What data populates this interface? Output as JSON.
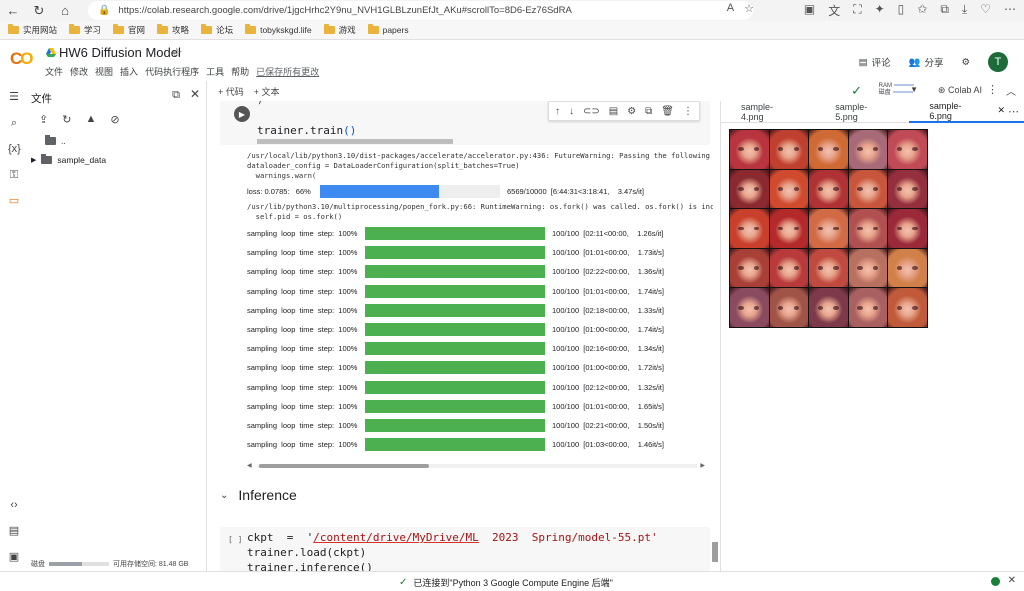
{
  "browser": {
    "url": "https://colab.research.google.com/drive/1jgcHrhc2Y9nu_NVH1GLBLzunEfJt_AKu#scrollTo=8D6-Ez76SdRA",
    "bookmarks": [
      "实用网站",
      "学习",
      "官网",
      "攻略",
      "论坛",
      "tobykskgd.life",
      "游戏",
      "papers"
    ]
  },
  "header": {
    "title": "HW6 Diffusion Model",
    "menu": [
      "文件",
      "修改",
      "视图",
      "插入",
      "代码执行程序",
      "工具",
      "帮助"
    ],
    "saved": "已保存所有更改",
    "comment": "评论",
    "share": "分享",
    "avatar_letter": "T"
  },
  "toolbar": {
    "add_code": "+ 代码",
    "add_text": "+ 文本",
    "ram": "RAM",
    "disk": "磁盘",
    "colab_ai": "Colab AI"
  },
  "files": {
    "title": "文件",
    "parent": "..",
    "folder": "sample_data",
    "disk_label": "磁盘",
    "disk_avail": "可用存储空间: 81.48 GB",
    "disk_used_fraction": 0.55
  },
  "cell1": {
    "prev": ")",
    "code_fn": "trainer.train",
    "code_parens": "()"
  },
  "output": {
    "warn1": "/usr/local/lib/python3.10/dist-packages/accelerate/accelerator.py:436: FutureWarning: Passing the following ar",
    "warn2": "dataloader_config = DataLoaderConfiguration(split_batches=True)",
    "warn3": "  warnings.warn(",
    "loss_label": "loss: 0.0785:   66%",
    "loss_tail": "6569/10000  [6:44:31<3:18:41,    3.47s/it]",
    "loss_fraction": 0.66,
    "warn4": "/usr/lib/python3.10/multiprocessing/popen_fork.py:66: RuntimeWarning: os.fork() was called. os.fork() is incom",
    "warn5": "  self.pid = os.fork()",
    "sampling_label": "sampling  loop  time  step:  100%",
    "sampling": [
      "100/100  [02:11<00:00,    1.26s/it]",
      "100/100  [01:01<00:00,    1.73it/s]",
      "100/100  [02:22<00:00,    1.36s/it]",
      "100/100  [01:01<00:00,    1.74it/s]",
      "100/100  [02:18<00:00,    1.33s/it]",
      "100/100  [01:00<00:00,    1.74it/s]",
      "100/100  [02:16<00:00,    1.34s/it]",
      "100/100  [01:00<00:00,    1.72it/s]",
      "100/100  [02:12<00:00,    1.32s/it]",
      "100/100  [01:01<00:00,    1.65it/s]",
      "100/100  [02:21<00:00,    1.50s/it]",
      "100/100  [01:03<00:00,    1.46it/s]"
    ],
    "sampling_fraction": 1.0,
    "blue": "#3d8bf0",
    "green": "#4caf50"
  },
  "section": {
    "title": "Inference"
  },
  "cell2": {
    "bracket": "[ ]",
    "line1_a": "ckpt  =  '",
    "line1_path": "/content/drive/MyDrive/ML",
    "line1_b": "  2023  Spring/model-55.pt'",
    "line2": "trainer.load(ckpt)",
    "line3": "trainer.inference()"
  },
  "right_panel": {
    "tabs": [
      "sample-4.png",
      "sample-5.png",
      "sample-6.png"
    ],
    "active_tab": "sample-6.png",
    "face_colors": [
      "#b8343e",
      "#c0402f",
      "#d06a34",
      "#a86a78",
      "#c04a55",
      "#8a2a30",
      "#d04a2e",
      "#b03234",
      "#c8563c",
      "#94303e",
      "#c8402c",
      "#b42a2a",
      "#d26a46",
      "#b05050",
      "#9a2a3a",
      "#a84038",
      "#b83a3a",
      "#c04a40",
      "#b87060",
      "#d08048",
      "#8a4a60",
      "#a05448",
      "#7e3a4a",
      "#a86060",
      "#c05a3a"
    ]
  },
  "status": {
    "text": "已连接到\"Python 3 Google Compute Engine 后端\""
  }
}
